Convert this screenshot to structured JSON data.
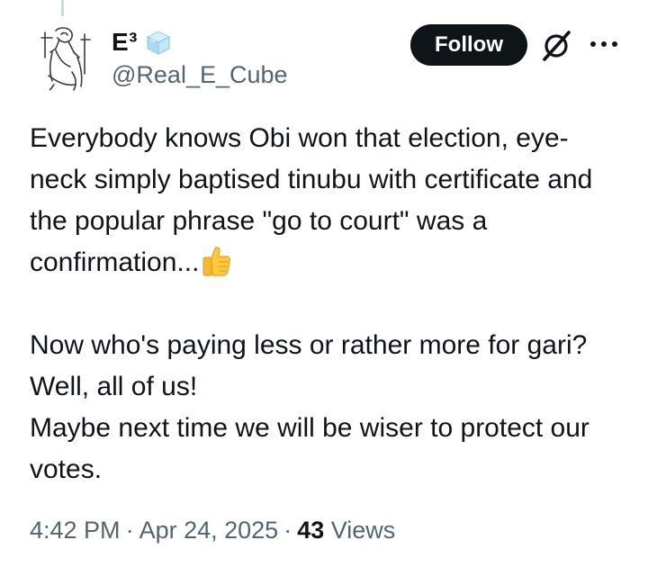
{
  "author": {
    "display_name": "E³",
    "handle": "@Real_E_Cube",
    "name_emoji": "ice-cube-emoji"
  },
  "actions": {
    "follow_label": "Follow",
    "grok_icon": "grok-icon",
    "more_icon": "more-icon"
  },
  "tweet": {
    "paragraph_1": "Everybody knows Obi won that election, eye-neck simply baptised tinubu with certificate and the popular phrase \"go to court\" was a confirmation...",
    "paragraph_1_emoji": "thumbs-up-emoji",
    "line_2a": "Now who's paying less or rather more for gari? Well, all of us!",
    "line_2b": "Maybe next time we will be wiser to protect our votes."
  },
  "meta": {
    "time": "4:42 PM",
    "date": "Apr 24, 2025",
    "separator": "·",
    "views_count": "43",
    "views_label": "Views"
  },
  "colors": {
    "primary_text": "#0f1419",
    "secondary_text": "#536471",
    "follow_bg": "#0f1419",
    "follow_text": "#ffffff"
  }
}
